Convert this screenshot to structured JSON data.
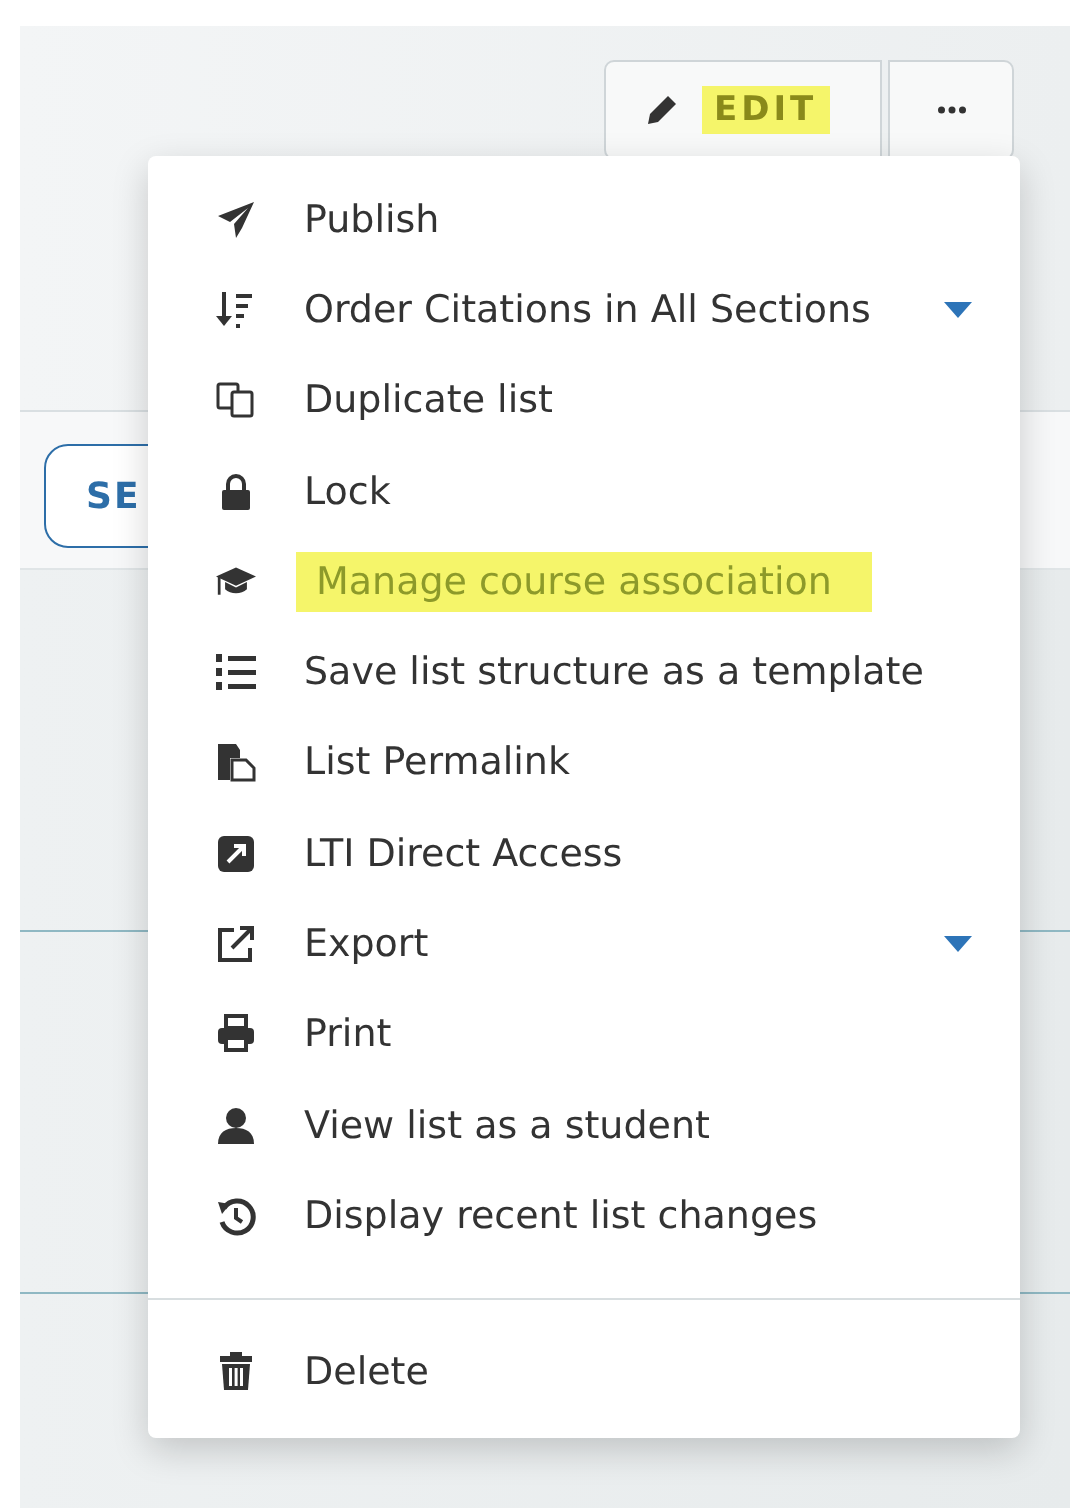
{
  "toolbar": {
    "edit_button": {
      "label": "EDIT",
      "highlighted": true
    }
  },
  "partial_button": {
    "label": "SE"
  },
  "menu": {
    "items": [
      {
        "label": "Publish",
        "highlighted": false,
        "submenu": false
      },
      {
        "label": "Order Citations in All Sections",
        "highlighted": false,
        "submenu": true
      },
      {
        "label": "Duplicate list",
        "highlighted": false,
        "submenu": false
      },
      {
        "label": "Lock",
        "highlighted": false,
        "submenu": false
      },
      {
        "label": "Manage course association",
        "highlighted": true,
        "submenu": false
      },
      {
        "label": "Save list structure as a template",
        "highlighted": false,
        "submenu": false
      },
      {
        "label": "List Permalink",
        "highlighted": false,
        "submenu": false
      },
      {
        "label": "LTI Direct Access",
        "highlighted": false,
        "submenu": false
      },
      {
        "label": "Export",
        "highlighted": false,
        "submenu": true
      },
      {
        "label": "Print",
        "highlighted": false,
        "submenu": false
      },
      {
        "label": "View list as a student",
        "highlighted": false,
        "submenu": false
      },
      {
        "label": "Display recent list changes",
        "highlighted": false,
        "submenu": false
      }
    ],
    "footer_items": [
      {
        "label": "Delete",
        "highlighted": false,
        "submenu": false
      }
    ]
  }
}
